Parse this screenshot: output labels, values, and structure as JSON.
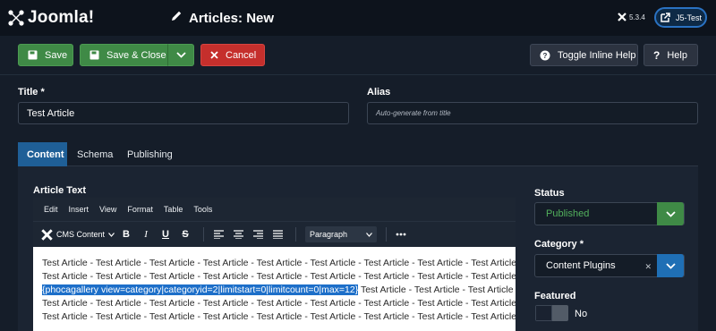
{
  "header": {
    "logo_text": "Joomla!",
    "title": "Articles: New",
    "version": "5.3.4",
    "user": "J5-Test"
  },
  "toolbar": {
    "save": "Save",
    "save_close": "Save & Close",
    "cancel": "Cancel",
    "toggle_help": "Toggle Inline Help",
    "help": "Help"
  },
  "form": {
    "title_label": "Title *",
    "title_value": "Test Article",
    "alias_label": "Alias",
    "alias_placeholder": "Auto-generate from title"
  },
  "tabs": [
    "Content",
    "Schema",
    "Publishing"
  ],
  "editor": {
    "label": "Article Text",
    "menus": [
      "Edit",
      "Insert",
      "View",
      "Format",
      "Table",
      "Tools"
    ],
    "cms_content": "CMS Content",
    "paragraph": "Paragraph",
    "lines": [
      "Test Article - Test Article - Test Article - Test Article - Test Article - Test Article - Test Article - Test Article - Test Article -",
      "Test Article - Test Article - Test Article - Test Article - Test Article - Test Article - Test Article - Test Article - Test Article -",
      "Test Article - Test Article - Test Article - Test Article - Test Article - Test Article - Test Article - Test Article - Test Article -",
      "Test Article - Test Article - Test Article - Test Article - Test Article - Test Article - Test Article - Test Article - Test Article -"
    ],
    "highlight": "{phocagallery view=category|categoryid=2|limitstart=0|limitcount=0|max=12}",
    "after_highlight": " Test Article - Test Article - Test Article -"
  },
  "sidebar": {
    "status_label": "Status",
    "status_value": "Published",
    "category_label": "Category *",
    "category_value": "Content Plugins",
    "featured_label": "Featured",
    "featured_value": "No"
  },
  "colors": {
    "accent_blue": "#1f5f97",
    "green": "#3f8a46",
    "red": "#c52f2c"
  }
}
